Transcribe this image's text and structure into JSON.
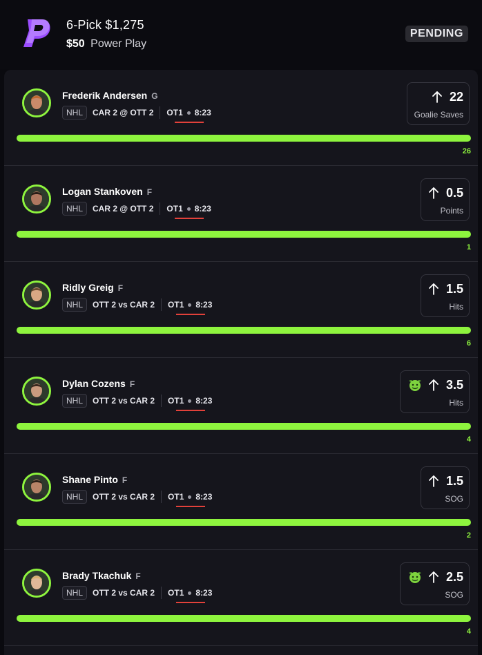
{
  "header": {
    "title": "6-Pick $1,275",
    "entry_amount": "$50",
    "play_type": "Power Play",
    "status": "PENDING"
  },
  "colors": {
    "accent_green": "#8ef43e",
    "live_red": "#e2413a",
    "brand_purple": "#9b4dff"
  },
  "picks": [
    {
      "player": "Frederik Andersen",
      "position": "G",
      "league": "NHL",
      "matchup": "CAR 2 @ OTT 2",
      "period": "OT1",
      "clock": "8:23",
      "line": "22",
      "stat": "Goalie Saves",
      "actual": "26",
      "demon": false,
      "direction_icon": "arrow-up-icon",
      "progress": 1.0
    },
    {
      "player": "Logan Stankoven",
      "position": "F",
      "league": "NHL",
      "matchup": "CAR 2 @ OTT 2",
      "period": "OT1",
      "clock": "8:23",
      "line": "0.5",
      "stat": "Points",
      "actual": "1",
      "demon": false,
      "direction_icon": "arrow-up-icon",
      "progress": 1.0
    },
    {
      "player": "Ridly Greig",
      "position": "F",
      "league": "NHL",
      "matchup": "OTT 2 vs CAR 2",
      "period": "OT1",
      "clock": "8:23",
      "line": "1.5",
      "stat": "Hits",
      "actual": "6",
      "demon": false,
      "direction_icon": "arrow-up-icon",
      "progress": 1.0
    },
    {
      "player": "Dylan Cozens",
      "position": "F",
      "league": "NHL",
      "matchup": "OTT 2 vs CAR 2",
      "period": "OT1",
      "clock": "8:23",
      "line": "3.5",
      "stat": "Hits",
      "actual": "4",
      "demon": true,
      "direction_icon": "arrow-up-icon",
      "progress": 1.0
    },
    {
      "player": "Shane Pinto",
      "position": "F",
      "league": "NHL",
      "matchup": "OTT 2 vs CAR 2",
      "period": "OT1",
      "clock": "8:23",
      "line": "1.5",
      "stat": "SOG",
      "actual": "2",
      "demon": false,
      "direction_icon": "arrow-up-icon",
      "progress": 1.0
    },
    {
      "player": "Brady Tkachuk",
      "position": "F",
      "league": "NHL",
      "matchup": "OTT 2 vs CAR 2",
      "period": "OT1",
      "clock": "8:23",
      "line": "2.5",
      "stat": "SOG",
      "actual": "4",
      "demon": true,
      "direction_icon": "arrow-up-icon",
      "progress": 1.0
    }
  ]
}
